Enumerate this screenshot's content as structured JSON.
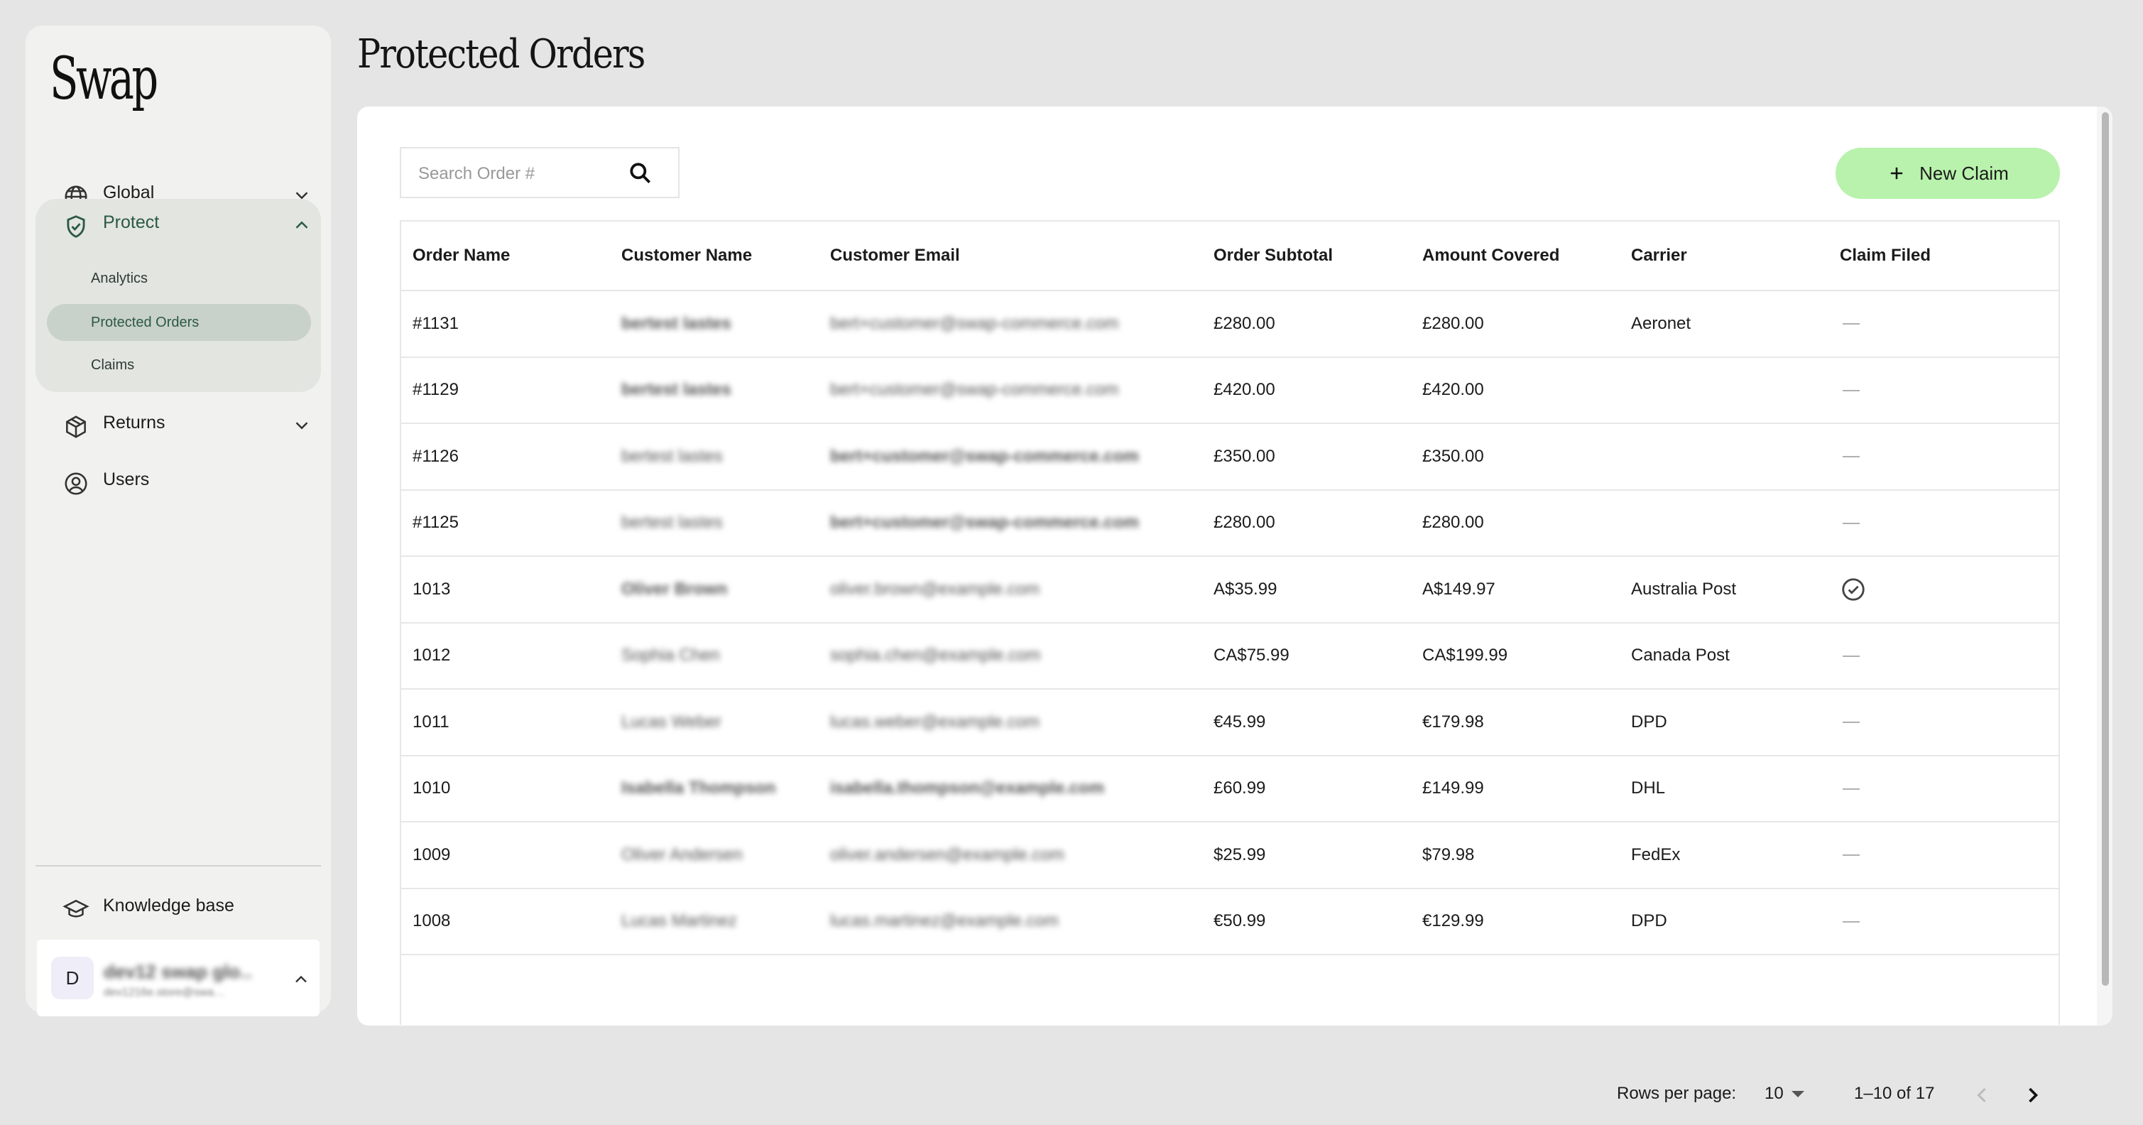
{
  "sidebar": {
    "logo": "Swap",
    "nav": {
      "global": "Global",
      "protect": "Protect",
      "returns": "Returns",
      "users": "Users"
    },
    "protect_sub": {
      "analytics": "Analytics",
      "protected_orders": "Protected Orders",
      "claims": "Claims"
    },
    "knowledge_base": "Knowledge base",
    "profile": {
      "initial": "D",
      "name": "dev12 swap glo…",
      "email": "dev1216e.store@swa…"
    }
  },
  "page": {
    "title": "Protected Orders"
  },
  "search": {
    "placeholder": "Search Order #"
  },
  "new_claim_label": "New Claim",
  "table": {
    "columns": [
      "Order Name",
      "Customer Name",
      "Customer Email",
      "Order Subtotal",
      "Amount Covered",
      "Carrier",
      "Claim Filed"
    ],
    "rows": [
      {
        "order": "#1131",
        "name": "bertest lastes",
        "email": "bert+customer@swap-commerce.com",
        "subtotal": "£280.00",
        "covered": "£280.00",
        "carrier": "Aeronet",
        "claim": false
      },
      {
        "order": "#1129",
        "name": "bertest lastes",
        "email": "bert+customer@swap-commerce.com",
        "subtotal": "£420.00",
        "covered": "£420.00",
        "carrier": "",
        "claim": false
      },
      {
        "order": "#1126",
        "name": "bertest lastes",
        "email": "bert+customer@swap-commerce.com",
        "subtotal": "£350.00",
        "covered": "£350.00",
        "carrier": "",
        "claim": false
      },
      {
        "order": "#1125",
        "name": "bertest lastes",
        "email": "bert+customer@swap-commerce.com",
        "subtotal": "£280.00",
        "covered": "£280.00",
        "carrier": "",
        "claim": false
      },
      {
        "order": "1013",
        "name": "Oliver Brown",
        "email": "oliver.brown@example.com",
        "subtotal": "A$35.99",
        "covered": "A$149.97",
        "carrier": "Australia Post",
        "claim": true
      },
      {
        "order": "1012",
        "name": "Sophia Chen",
        "email": "sophia.chen@example.com",
        "subtotal": "CA$75.99",
        "covered": "CA$199.99",
        "carrier": "Canada Post",
        "claim": false
      },
      {
        "order": "1011",
        "name": "Lucas Weber",
        "email": "lucas.weber@example.com",
        "subtotal": "€45.99",
        "covered": "€179.98",
        "carrier": "DPD",
        "claim": false
      },
      {
        "order": "1010",
        "name": "Isabella Thompson",
        "email": "isabella.thompson@example.com",
        "subtotal": "£60.99",
        "covered": "£149.99",
        "carrier": "DHL",
        "claim": false
      },
      {
        "order": "1009",
        "name": "Oliver Andersen",
        "email": "oliver.andersen@example.com",
        "subtotal": "$25.99",
        "covered": "$79.98",
        "carrier": "FedEx",
        "claim": false
      },
      {
        "order": "1008",
        "name": "Lucas Martinez",
        "email": "lucas.martinez@example.com",
        "subtotal": "€50.99",
        "covered": "€129.99",
        "carrier": "DPD",
        "claim": false
      }
    ]
  },
  "pagination": {
    "rows_per_page_label": "Rows per page:",
    "rows_per_page": "10",
    "range": "1–10 of 17"
  }
}
